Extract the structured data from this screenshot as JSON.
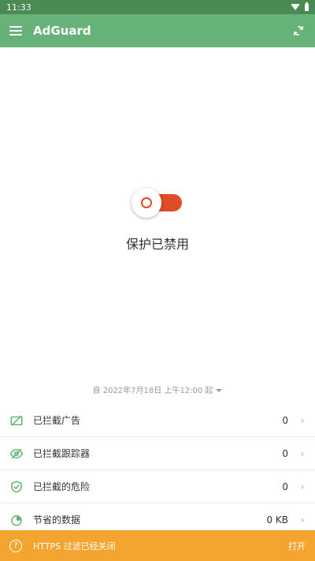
{
  "status_bar": {
    "time": "11:33"
  },
  "app_bar": {
    "title": "AdGuard"
  },
  "protection": {
    "status_text": "保护已禁用",
    "enabled": false
  },
  "since": {
    "text": "自 2022年7月18日 上午12:00 起"
  },
  "stats": [
    {
      "label": "已拦截广告",
      "value": "0",
      "icon": "ads-blocked-icon"
    },
    {
      "label": "已拦截跟踪器",
      "value": "0",
      "icon": "trackers-blocked-icon"
    },
    {
      "label": "已拦截的危险",
      "value": "0",
      "icon": "threats-blocked-icon"
    },
    {
      "label": "节省的数据",
      "value": "0 KB",
      "icon": "data-saved-icon"
    }
  ],
  "banner": {
    "text": "HTTPS 过滤已经关闭",
    "action": "打开",
    "icon": "question-icon"
  },
  "colors": {
    "app_bar": "#67b279",
    "status_bar": "#4a8a55",
    "toggle_off": "#e04c26",
    "banner": "#f3a530",
    "icon_green": "#67b279"
  }
}
